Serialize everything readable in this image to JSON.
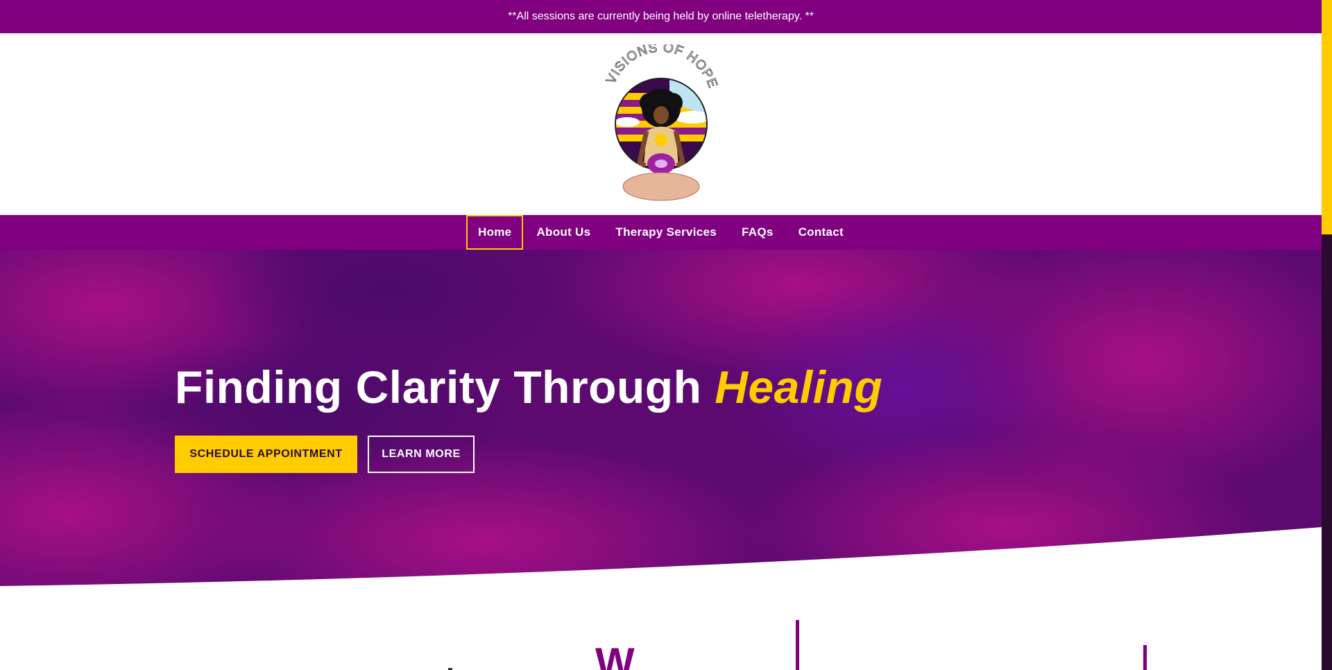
{
  "announcement": {
    "text": "**All sessions are currently being held by online teletherapy. **"
  },
  "logo": {
    "text": "VISIONS OF HOPE",
    "icon": "visions-of-hope-logo"
  },
  "nav": {
    "items": [
      {
        "label": "Home",
        "active": true
      },
      {
        "label": "About Us",
        "active": false
      },
      {
        "label": "Therapy Services",
        "active": false
      },
      {
        "label": "FAQs",
        "active": false
      },
      {
        "label": "Contact",
        "active": false
      }
    ]
  },
  "hero": {
    "title": "Finding Clarity Through",
    "title_accent": "Healing",
    "primary_button": "SCHEDULE APPOINTMENT",
    "secondary_button": "LEARN MORE"
  },
  "section": {
    "heading_partial": "W"
  },
  "colors": {
    "brand_purple": "#800080",
    "accent_yellow": "#ffcc00",
    "hero_base": "#5a0a72"
  }
}
